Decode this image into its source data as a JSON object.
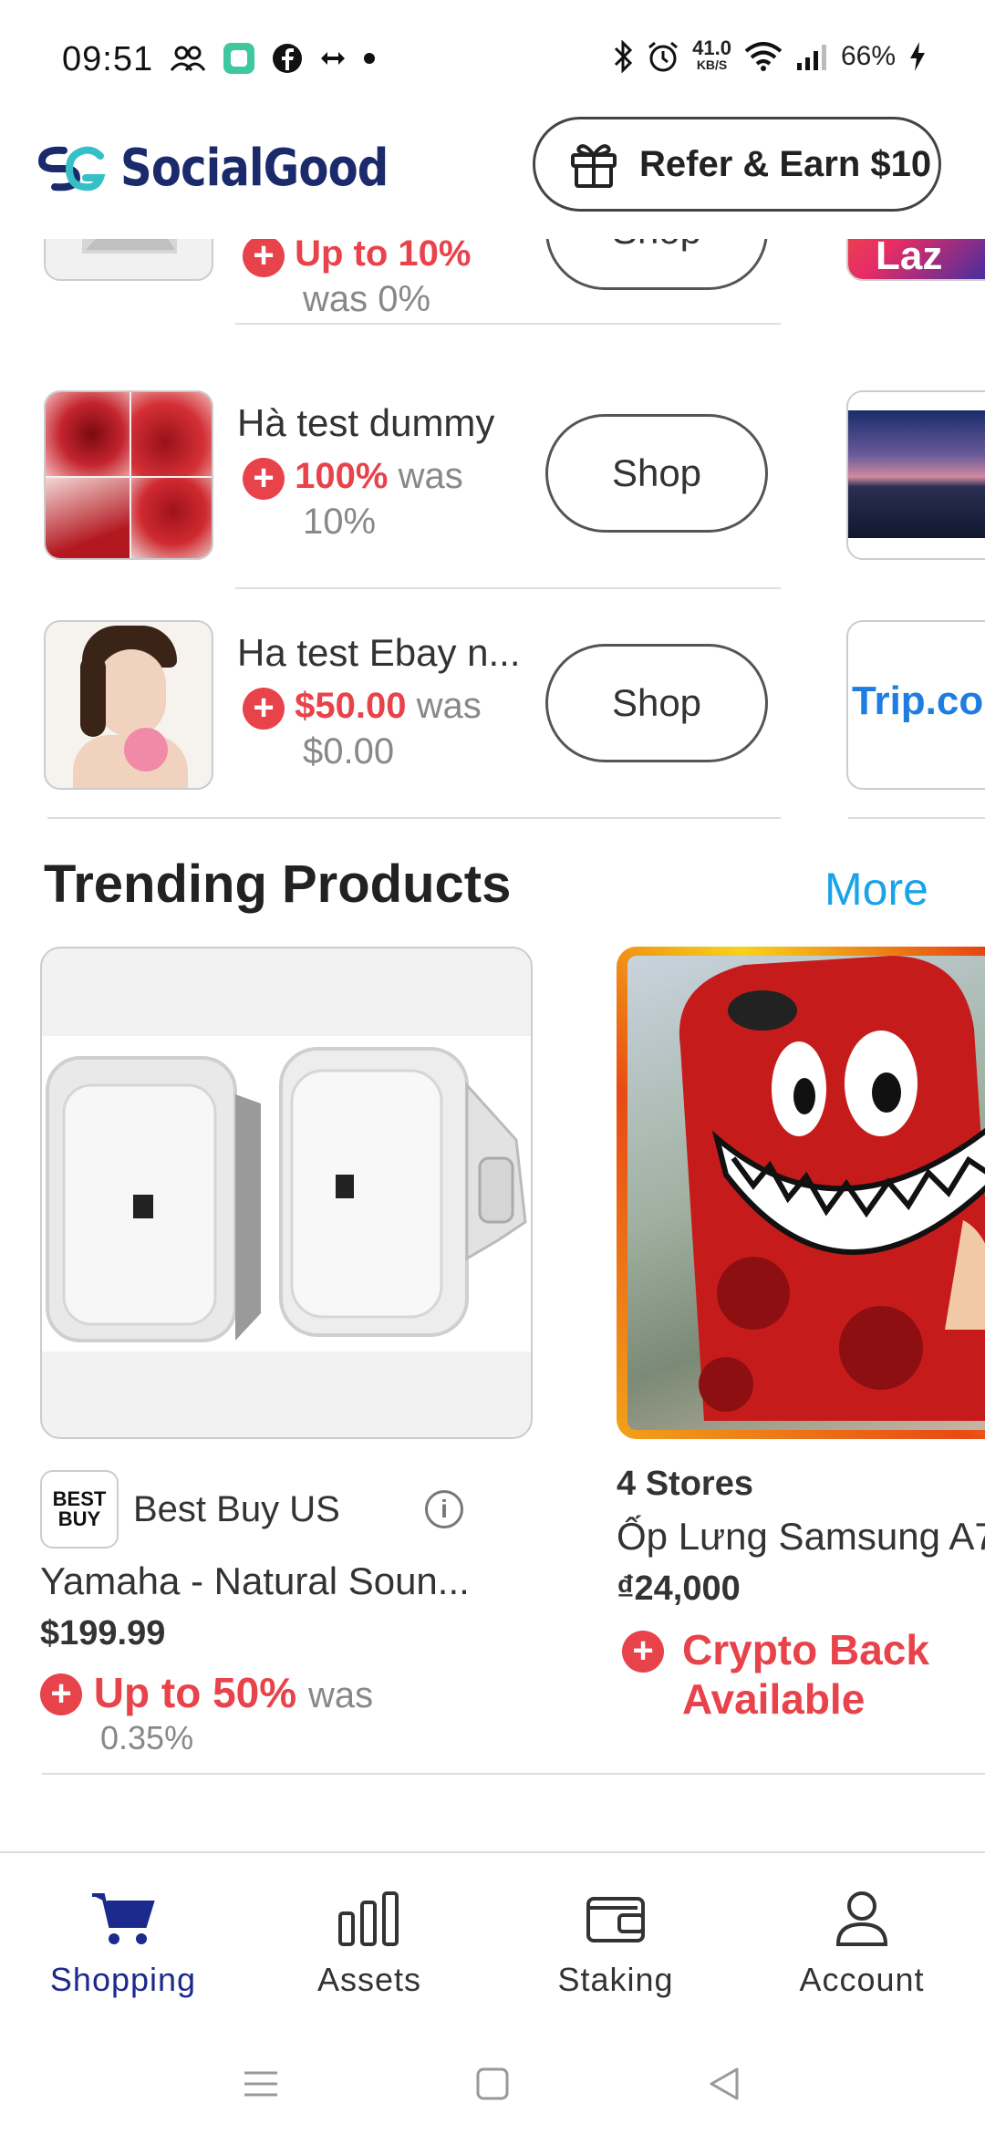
{
  "status_bar": {
    "time": "09:51",
    "speed_value": "41.0",
    "speed_unit": "KB/S",
    "battery": "66%",
    "icons": [
      "group-icon",
      "app-icon",
      "facebook-icon",
      "arrows-icon",
      "dot-icon",
      "bluetooth-icon",
      "alarm-icon",
      "wifi-icon",
      "signal-icon",
      "charging-icon"
    ]
  },
  "header": {
    "app_name": "SocialGood",
    "refer_label": "Refer & Earn $10"
  },
  "stores": [
    {
      "name": "",
      "rate": "Up to 10%",
      "was": "was 0%",
      "shop_label": "Shop"
    },
    {
      "name": "Hà test dummy",
      "rate": "100%",
      "was_word": "was",
      "was_value": "10%",
      "shop_label": "Shop"
    },
    {
      "name": "Ha test Ebay n...",
      "rate": "$50.00",
      "was_word": "was",
      "was_value": "$0.00",
      "shop_label": "Shop"
    }
  ],
  "side_cards": [
    {
      "label": "Laz"
    },
    {
      "label": ""
    },
    {
      "label": "Trip.com"
    }
  ],
  "trending": {
    "title": "Trending Products",
    "more_label": "More",
    "products": [
      {
        "store_logo": "BEST BUY",
        "store": "Best Buy US",
        "name": "Yamaha - Natural Soun...",
        "price": "$199.99",
        "rate": "Up to 50%",
        "was_word": "was",
        "was_value": "0.35%"
      },
      {
        "store": "4 Stores",
        "name": "Ốp Lưng Samsung A7",
        "price": "₫24,000",
        "crypto_line1": "Crypto Back",
        "crypto_line2": "Available"
      }
    ]
  },
  "nav": {
    "items": [
      {
        "label": "Shopping",
        "icon": "cart-icon",
        "active": true
      },
      {
        "label": "Assets",
        "icon": "bars-icon",
        "active": false
      },
      {
        "label": "Staking",
        "icon": "wallet-icon",
        "active": false
      },
      {
        "label": "Account",
        "icon": "person-icon",
        "active": false
      }
    ]
  },
  "colors": {
    "accent_red": "#e8434b",
    "brand_navy": "#1b2a6b",
    "link_blue": "#1aa3e8"
  }
}
